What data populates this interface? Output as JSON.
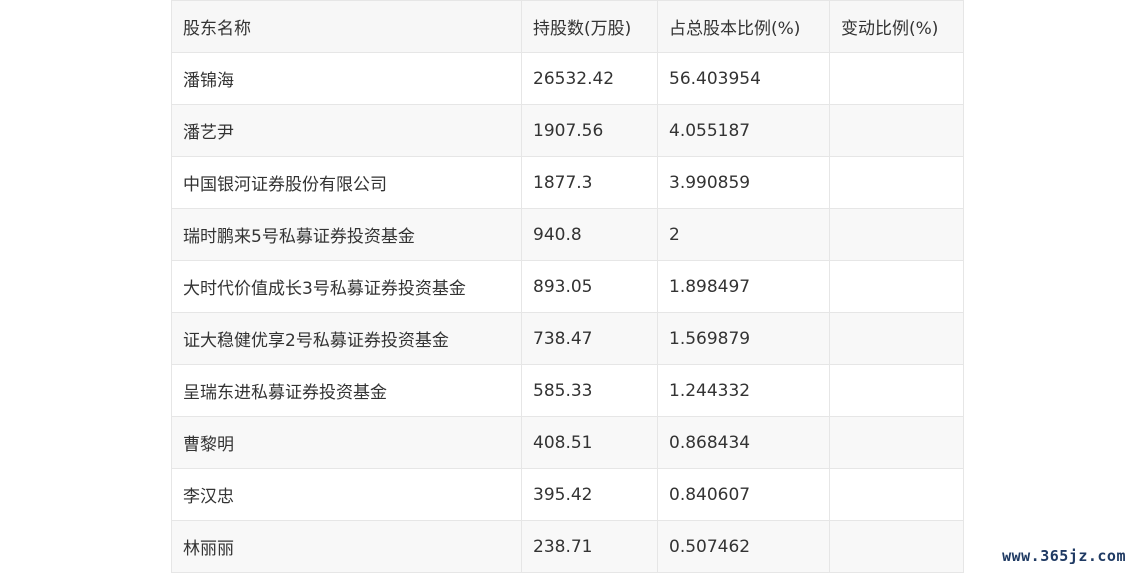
{
  "table": {
    "headers": [
      "股东名称",
      "持股数(万股)",
      "占总股本比例(%)",
      "变动比例(%)"
    ],
    "rows": [
      {
        "name": "潘锦海",
        "shares": "26532.42",
        "ratio": "56.403954",
        "change": ""
      },
      {
        "name": "潘艺尹",
        "shares": "1907.56",
        "ratio": "4.055187",
        "change": ""
      },
      {
        "name": "中国银河证券股份有限公司",
        "shares": "1877.3",
        "ratio": "3.990859",
        "change": ""
      },
      {
        "name": "瑞时鹏来5号私募证券投资基金",
        "shares": "940.8",
        "ratio": "2",
        "change": ""
      },
      {
        "name": "大时代价值成长3号私募证券投资基金",
        "shares": "893.05",
        "ratio": "1.898497",
        "change": ""
      },
      {
        "name": "证大稳健优享2号私募证券投资基金",
        "shares": "738.47",
        "ratio": "1.569879",
        "change": ""
      },
      {
        "name": "呈瑞东进私募证券投资基金",
        "shares": "585.33",
        "ratio": "1.244332",
        "change": ""
      },
      {
        "name": "曹黎明",
        "shares": "408.51",
        "ratio": "0.868434",
        "change": ""
      },
      {
        "name": "李汉忠",
        "shares": "395.42",
        "ratio": "0.840607",
        "change": ""
      },
      {
        "name": "林丽丽",
        "shares": "238.71",
        "ratio": "0.507462",
        "change": ""
      }
    ]
  },
  "watermark": "www.365jz.com"
}
